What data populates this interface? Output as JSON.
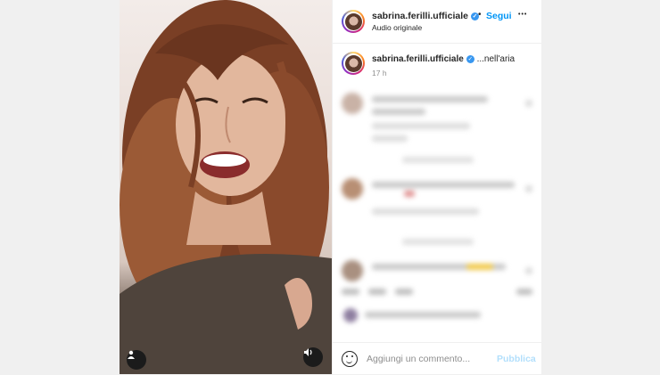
{
  "header": {
    "username": "sabrina.ferilli.ufficiale",
    "separator": "•",
    "follow_label": "Segui",
    "audio_label": "Audio originale",
    "more_label": "•••"
  },
  "caption": {
    "username": "sabrina.ferilli.ufficiale",
    "text": "...nell'aria",
    "time": "17 h"
  },
  "footer": {
    "comment_placeholder": "Aggiungi un commento...",
    "publish_label": "Pubblica"
  },
  "icons": {
    "verified": "✓",
    "user_tag": "person-icon",
    "audio": "speaker-icon"
  },
  "colors": {
    "accent": "#0095f6",
    "publish_disabled": "#b2dffc",
    "verified": "#3897f0"
  }
}
